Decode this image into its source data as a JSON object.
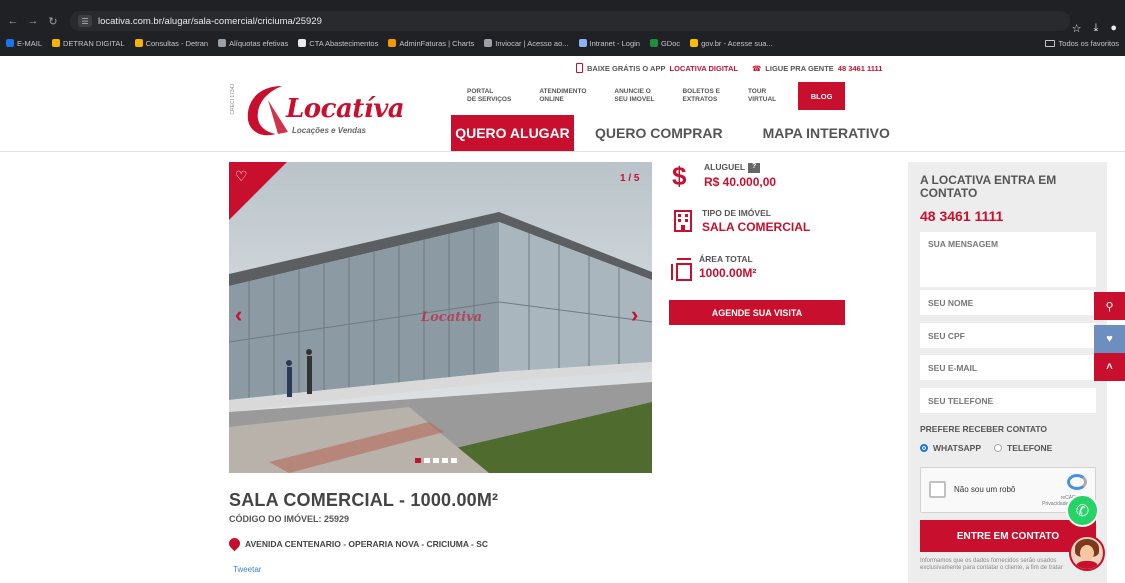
{
  "browser": {
    "url_host": "locativa.com.br",
    "url_path": "/alugar/sala-comercial/criciuma/25929",
    "bookmarks": [
      {
        "label": "E-MAIL",
        "color": "#1a73e8"
      },
      {
        "label": "DETRAN DIGITAL",
        "color": "#f4b400"
      },
      {
        "label": "Consultas - Detran",
        "color": "#f4b400"
      },
      {
        "label": "Alíquotas efetivas",
        "color": "#9aa0a6"
      },
      {
        "label": "CTA Abastecimentos",
        "color": "#e8eaed"
      },
      {
        "label": "AdminFaturas | Charts",
        "color": "#f29900"
      },
      {
        "label": "Inviocar | Acesso ao...",
        "color": "#9aa0a6"
      },
      {
        "label": "Intranet - Login",
        "color": "#8ab4f8"
      },
      {
        "label": "GDoc",
        "color": "#1e8e3e"
      },
      {
        "label": "gov.br - Acesse sua...",
        "color": "#fbbc04"
      }
    ],
    "all_bookmarks": "Todos os favoritos"
  },
  "header": {
    "app_text": "BAIXE GRÁTIS O APP",
    "app_brand": "LOCATIVA DIGITAL",
    "call_text": "LIGUE PRA GENTE",
    "call_number": "48 3461 1111",
    "logo_word": "Locatíva",
    "logo_sub": "Locações e Vendas",
    "logo_creci": "CRECI 1734J",
    "menu": [
      "PORTAL\nDE SERVIÇOS",
      "ATENDIMENTO\nONLINE",
      "ANUNCIE O\nSEU IMOVEL",
      "BOLETOS E\nEXTRATOS",
      "TOUR\nVIRTUAL"
    ],
    "blog": "BLOG",
    "tabs": [
      "QUERO ALUGAR",
      "QUERO COMPRAR",
      "MAPA INTERATIVO"
    ]
  },
  "gallery": {
    "counter": "1 / 5",
    "watermark": "Locativa",
    "dots_total": 5,
    "dots_active": 1
  },
  "info": {
    "rent_label": "ALUGUEL",
    "rent_help": "?",
    "rent_value": "R$ 40.000,00",
    "type_label": "TIPO DE IMÓVEL",
    "type_value": "SALA COMERCIAL",
    "area_label": "ÁREA TOTAL",
    "area_value": "1000.00M²",
    "visit_button": "AGENDE SUA VISITA"
  },
  "listing": {
    "title": "SALA COMERCIAL - 1000.00M²",
    "code": "CÓDIGO DO IMÓVEL: 25929",
    "address": "AVENIDA CENTENARIO - OPERARIA NOVA - CRICIUMA - SC",
    "tweet": "Tweetar"
  },
  "contact": {
    "heading": "A LOCATIVA ENTRA EM CONTATO",
    "phone": "48 3461 1111",
    "message_placeholder": "SUA MENSAGEM",
    "name_placeholder": "SEU NOME",
    "cpf_placeholder": "SEU CPF",
    "email_placeholder": "SEU E-MAIL",
    "phone_placeholder": "SEU TELEFONE",
    "prefer_label": "PREFERE RECEBER CONTATO",
    "options": [
      "WHATSAPP",
      "TELEFONE"
    ],
    "selected": "WHATSAPP",
    "captcha_label": "Não sou um robô",
    "captcha_brand": "reCAPTCHA",
    "captcha_sub": "Privacidade - Termos",
    "submit": "ENTRE EM CONTATO",
    "disclaimer": "Informamos que os dados fornecidos serão usados exclusivamente para contatar o cliente, a fim de tratar"
  },
  "colors": {
    "brand_red": "#c8102e",
    "whatsapp": "#25d366",
    "side_blue": "#6c8fbf"
  }
}
